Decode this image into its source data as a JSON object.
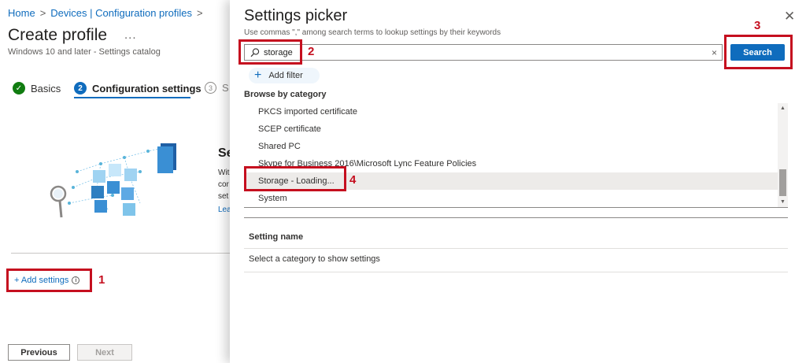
{
  "breadcrumb": {
    "home": "Home",
    "parent": "Devices | Configuration profiles"
  },
  "page": {
    "title": "Create profile",
    "more": "...",
    "subtitle": "Windows 10 and later - Settings catalog"
  },
  "wizard": {
    "steps": [
      {
        "label": "Basics",
        "state": "complete"
      },
      {
        "label": "Configuration settings",
        "number": "2",
        "state": "current"
      },
      {
        "label": "S",
        "number": "3",
        "state": "upcoming"
      }
    ]
  },
  "config_section": {
    "heading": "Se",
    "desc_lines": [
      "Wit",
      "cor",
      "set"
    ],
    "link": "Lea",
    "add_settings": "+ Add settings"
  },
  "footer": {
    "previous": "Previous",
    "next": "Next"
  },
  "picker": {
    "title": "Settings picker",
    "hint": "Use commas \",\" among search terms to lookup settings by their keywords",
    "search_value": "storage",
    "search_button": "Search",
    "add_filter": "Add filter",
    "browse_label": "Browse by category",
    "categories": [
      "PKCS imported certificate",
      "SCEP certificate",
      "Shared PC",
      "Skype for Business 2016\\Microsoft Lync Feature Policies",
      "Storage - Loading...",
      "System"
    ],
    "selected_category": "Storage - Loading...",
    "table": {
      "header": "Setting name",
      "empty_message": "Select a category to show settings"
    }
  },
  "callouts": [
    "1",
    "2",
    "3",
    "4"
  ],
  "colors": {
    "accent": "#0f6cbd",
    "callout": "#c50f1f",
    "success": "#107c10"
  }
}
